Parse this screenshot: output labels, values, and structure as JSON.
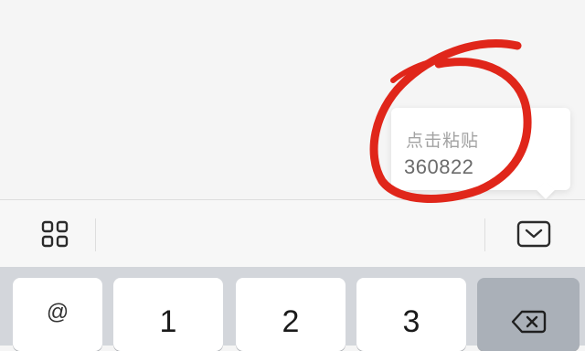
{
  "clipboard_suggestion": {
    "hint": "点击粘贴",
    "code": "360822"
  },
  "toolbar": {
    "left_icon": "grid-icon",
    "right_icon": "keyboard-hide-icon"
  },
  "keyboard": {
    "keys": [
      "@",
      "1",
      "2",
      "3"
    ],
    "delete_icon": "backspace-icon"
  },
  "annotation": {
    "shape": "hand-drawn circle",
    "color": "#e0261a"
  }
}
